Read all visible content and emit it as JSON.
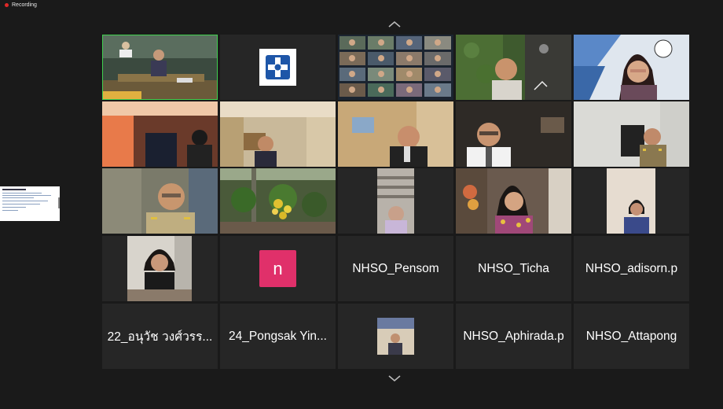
{
  "recording": {
    "label": "Recording"
  },
  "navigation": {
    "up_icon": "chevron-up-icon",
    "down_icon": "chevron-down-icon"
  },
  "shared_screen": {
    "type": "document-thumbnail"
  },
  "colors": {
    "active_speaker_border": "#3fcf4f",
    "avatar_bg": "#e0306a",
    "recording_dot": "#e02828",
    "background": "#1a1a1a",
    "tile_bg": "#262626"
  },
  "participants": [
    {
      "kind": "video",
      "scene": "conference-room"
    },
    {
      "kind": "video",
      "scene": "nhso-logo"
    },
    {
      "kind": "video",
      "scene": "gallery-of-people"
    },
    {
      "kind": "video",
      "scene": "man-plants"
    },
    {
      "kind": "video",
      "scene": "woman-glasses"
    },
    {
      "kind": "video",
      "scene": "woman-office"
    },
    {
      "kind": "video",
      "scene": "man-office"
    },
    {
      "kind": "video",
      "scene": "man-desk"
    },
    {
      "kind": "video",
      "scene": "man-glasses"
    },
    {
      "kind": "video",
      "scene": "man-uniform"
    },
    {
      "kind": "video",
      "scene": "man-uniform-glasses"
    },
    {
      "kind": "video",
      "scene": "flowers"
    },
    {
      "kind": "video",
      "scene": "person-window"
    },
    {
      "kind": "video",
      "scene": "woman-flowers"
    },
    {
      "kind": "video",
      "scene": "woman-room"
    },
    {
      "kind": "video",
      "scene": "woman-portrait"
    },
    {
      "kind": "avatar",
      "initial": "n"
    },
    {
      "kind": "name",
      "label": "NHSO_Pensom"
    },
    {
      "kind": "name",
      "label": "NHSO_Ticha"
    },
    {
      "kind": "name",
      "label": "NHSO_adisorn.p"
    },
    {
      "kind": "name",
      "label": "22_อนุวัช วงศ์วรร..."
    },
    {
      "kind": "name",
      "label": "24_Pongsak Yin..."
    },
    {
      "kind": "video",
      "scene": "small-screen"
    },
    {
      "kind": "name",
      "label": "NHSO_Aphirada.p"
    },
    {
      "kind": "name",
      "label": "NHSO_Attapong"
    }
  ]
}
